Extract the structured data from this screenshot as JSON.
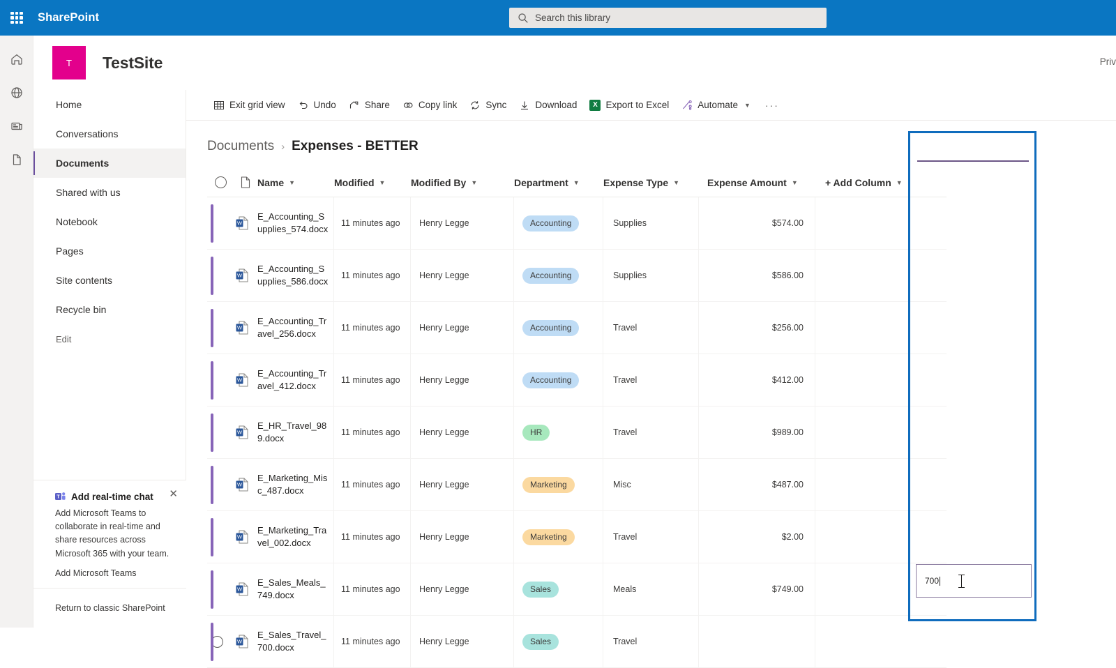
{
  "suite": {
    "brand": "SharePoint",
    "waffle_icon": "app-launcher-icon",
    "search": {
      "placeholder": "Search this library",
      "value": "",
      "icon": "search-icon"
    }
  },
  "rail": {
    "items": [
      {
        "name": "home-icon",
        "label": "Home"
      },
      {
        "name": "globe-icon",
        "label": "Sites"
      },
      {
        "name": "news-icon",
        "label": "News"
      },
      {
        "name": "files-icon",
        "label": "Files"
      }
    ]
  },
  "site": {
    "logo_letter": "T",
    "logo_color": "#e3008c",
    "title": "TestSite",
    "privacy": "Priv"
  },
  "nav": {
    "items": [
      {
        "label": "Home",
        "selected": false
      },
      {
        "label": "Conversations",
        "selected": false
      },
      {
        "label": "Documents",
        "selected": true
      },
      {
        "label": "Shared with us",
        "selected": false
      },
      {
        "label": "Notebook",
        "selected": false
      },
      {
        "label": "Pages",
        "selected": false
      },
      {
        "label": "Site contents",
        "selected": false
      },
      {
        "label": "Recycle bin",
        "selected": false
      }
    ],
    "edit_label": "Edit"
  },
  "promo": {
    "icon": "teams-icon",
    "close_icon": "close-icon",
    "title": "Add real-time chat",
    "body": "Add Microsoft Teams to collaborate in real-time and share resources across Microsoft 365 with your team.",
    "info_icon": "info-icon",
    "link": "Add Microsoft Teams"
  },
  "classic_link": "Return to classic SharePoint",
  "toolbar": {
    "items": [
      {
        "label": "Exit grid view",
        "icon": "grid-icon",
        "chevron": false
      },
      {
        "label": "Undo",
        "icon": "undo-icon",
        "chevron": false
      },
      {
        "label": "Share",
        "icon": "share-icon",
        "chevron": false
      },
      {
        "label": "Copy link",
        "icon": "link-icon",
        "chevron": false
      },
      {
        "label": "Sync",
        "icon": "sync-icon",
        "chevron": false
      },
      {
        "label": "Download",
        "icon": "download-icon",
        "chevron": false
      },
      {
        "label": "Export to Excel",
        "icon": "excel-icon",
        "chevron": false
      },
      {
        "label": "Automate",
        "icon": "automate-icon",
        "chevron": true
      }
    ],
    "overflow_label": "···"
  },
  "breadcrumb": {
    "root": "Documents",
    "separator": "›",
    "current": "Expenses - BETTER"
  },
  "grid": {
    "select_all_icon": "circle-select-icon",
    "file_type_icon": "document-icon",
    "columns": [
      {
        "label": "Name",
        "chevron": "⌄"
      },
      {
        "label": "Modified",
        "chevron": "⌄"
      },
      {
        "label": "Modified By",
        "chevron": "⌄"
      },
      {
        "label": "Department",
        "chevron": "⌄"
      },
      {
        "label": "Expense Type",
        "chevron": "⌄"
      },
      {
        "label": "Expense Amount",
        "chevron": "⌄"
      },
      {
        "label": "+ Add Column",
        "chevron": "⌄"
      }
    ],
    "selected_column": "Expense Amount",
    "selected_column_border_color": "#0f6cbd",
    "rows": [
      {
        "name": "E_Accounting_Supplies_574.docx",
        "modified": "11 minutes ago",
        "modified_by": "Henry Legge",
        "department": "Accounting",
        "dept_bg": "#bfdcf5",
        "expense_type": "Supplies",
        "amount": "$574.00"
      },
      {
        "name": "E_Accounting_Supplies_586.docx",
        "modified": "11 minutes ago",
        "modified_by": "Henry Legge",
        "department": "Accounting",
        "dept_bg": "#bfdcf5",
        "expense_type": "Supplies",
        "amount": "$586.00"
      },
      {
        "name": "E_Accounting_Travel_256.docx",
        "modified": "11 minutes ago",
        "modified_by": "Henry Legge",
        "department": "Accounting",
        "dept_bg": "#bfdcf5",
        "expense_type": "Travel",
        "amount": "$256.00"
      },
      {
        "name": "E_Accounting_Travel_412.docx",
        "modified": "11 minutes ago",
        "modified_by": "Henry Legge",
        "department": "Accounting",
        "dept_bg": "#bfdcf5",
        "expense_type": "Travel",
        "amount": "$412.00"
      },
      {
        "name": "E_HR_Travel_989.docx",
        "modified": "11 minutes ago",
        "modified_by": "Henry Legge",
        "department": "HR",
        "dept_bg": "#a7e8bd",
        "expense_type": "Travel",
        "amount": "$989.00"
      },
      {
        "name": "E_Marketing_Misc_487.docx",
        "modified": "11 minutes ago",
        "modified_by": "Henry Legge",
        "department": "Marketing",
        "dept_bg": "#fbd9a0",
        "expense_type": "Misc",
        "amount": "$487.00"
      },
      {
        "name": "E_Marketing_Travel_002.docx",
        "modified": "11 minutes ago",
        "modified_by": "Henry Legge",
        "department": "Marketing",
        "dept_bg": "#fbd9a0",
        "expense_type": "Travel",
        "amount": "$2.00"
      },
      {
        "name": "E_Sales_Meals_749.docx",
        "modified": "11 minutes ago",
        "modified_by": "Henry Legge",
        "department": "Sales",
        "dept_bg": "#a8e3dd",
        "expense_type": "Meals",
        "amount": "$749.00"
      },
      {
        "name": "E_Sales_Travel_700.docx",
        "modified": "11 minutes ago",
        "modified_by": "Henry Legge",
        "department": "Sales",
        "dept_bg": "#a8e3dd",
        "expense_type": "Travel",
        "amount": "",
        "editing": true
      }
    ],
    "editing_cell": {
      "value": "700",
      "row_index": 8,
      "column": "Expense Amount"
    }
  }
}
